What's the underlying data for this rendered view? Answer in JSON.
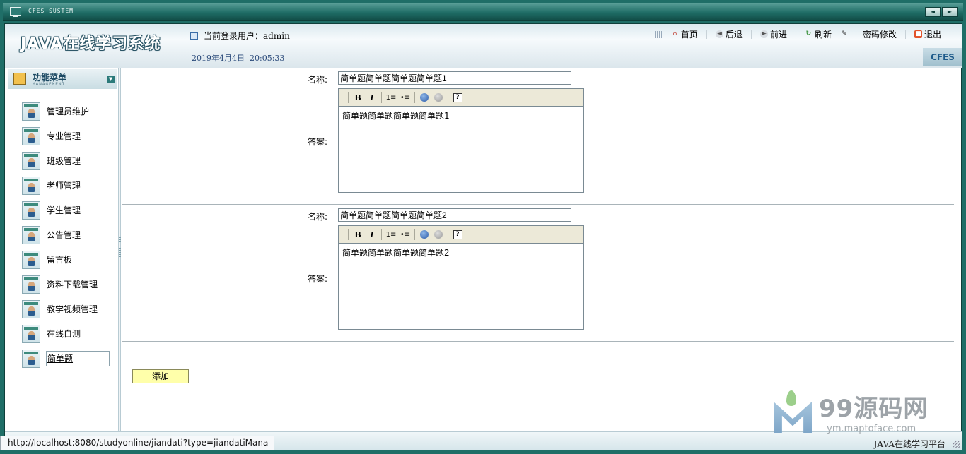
{
  "window": {
    "title": "CFES SUSTEM",
    "nav_prev": "◄",
    "nav_next": "►"
  },
  "header": {
    "logo": "JAVA在线学习系统",
    "current_user_label": "当前登录用户：",
    "current_user": "admin",
    "date": "2019年4月4日",
    "time": "20:05:33",
    "brand_badge": "CFES",
    "links": {
      "home": "首页",
      "back": "后退",
      "forward": "前进",
      "refresh": "刷新",
      "change_password": "密码修改",
      "logout": "退出"
    }
  },
  "sidebar": {
    "title": "功能菜单",
    "subtitle": "MANAGEMENT",
    "items": [
      {
        "label": "管理员维护"
      },
      {
        "label": "专业管理"
      },
      {
        "label": "班级管理"
      },
      {
        "label": "老师管理"
      },
      {
        "label": "学生管理"
      },
      {
        "label": "公告管理"
      },
      {
        "label": "留言板"
      },
      {
        "label": "资料下载管理"
      },
      {
        "label": "教学视频管理"
      },
      {
        "label": "在线自测"
      },
      {
        "label": "简单题"
      }
    ],
    "active_index": 10
  },
  "questions": [
    {
      "name_label": "名称:",
      "name_value": "简单题简单题简单题简单题1",
      "answer_label": "答案:",
      "answer_text": "简单题简单题简单题简单题1"
    },
    {
      "name_label": "名称:",
      "name_value": "简单题简单题简单题简单题2",
      "answer_label": "答案:",
      "answer_text": "简单题简单题简单题简单题2"
    }
  ],
  "editor_toolbar": {
    "bold": "B",
    "italic": "I",
    "ordered_list": "1≡",
    "unordered_list": "•≡",
    "help": "?"
  },
  "add_button": "添加",
  "footer": {
    "copyright": "JAVA在线学习平台"
  },
  "status_url": "http://localhost:8080/studyonline/jiandati?type=jiandatiMana",
  "watermark": {
    "brand": "99源码网",
    "site": "— ym.maptoface.com —"
  }
}
